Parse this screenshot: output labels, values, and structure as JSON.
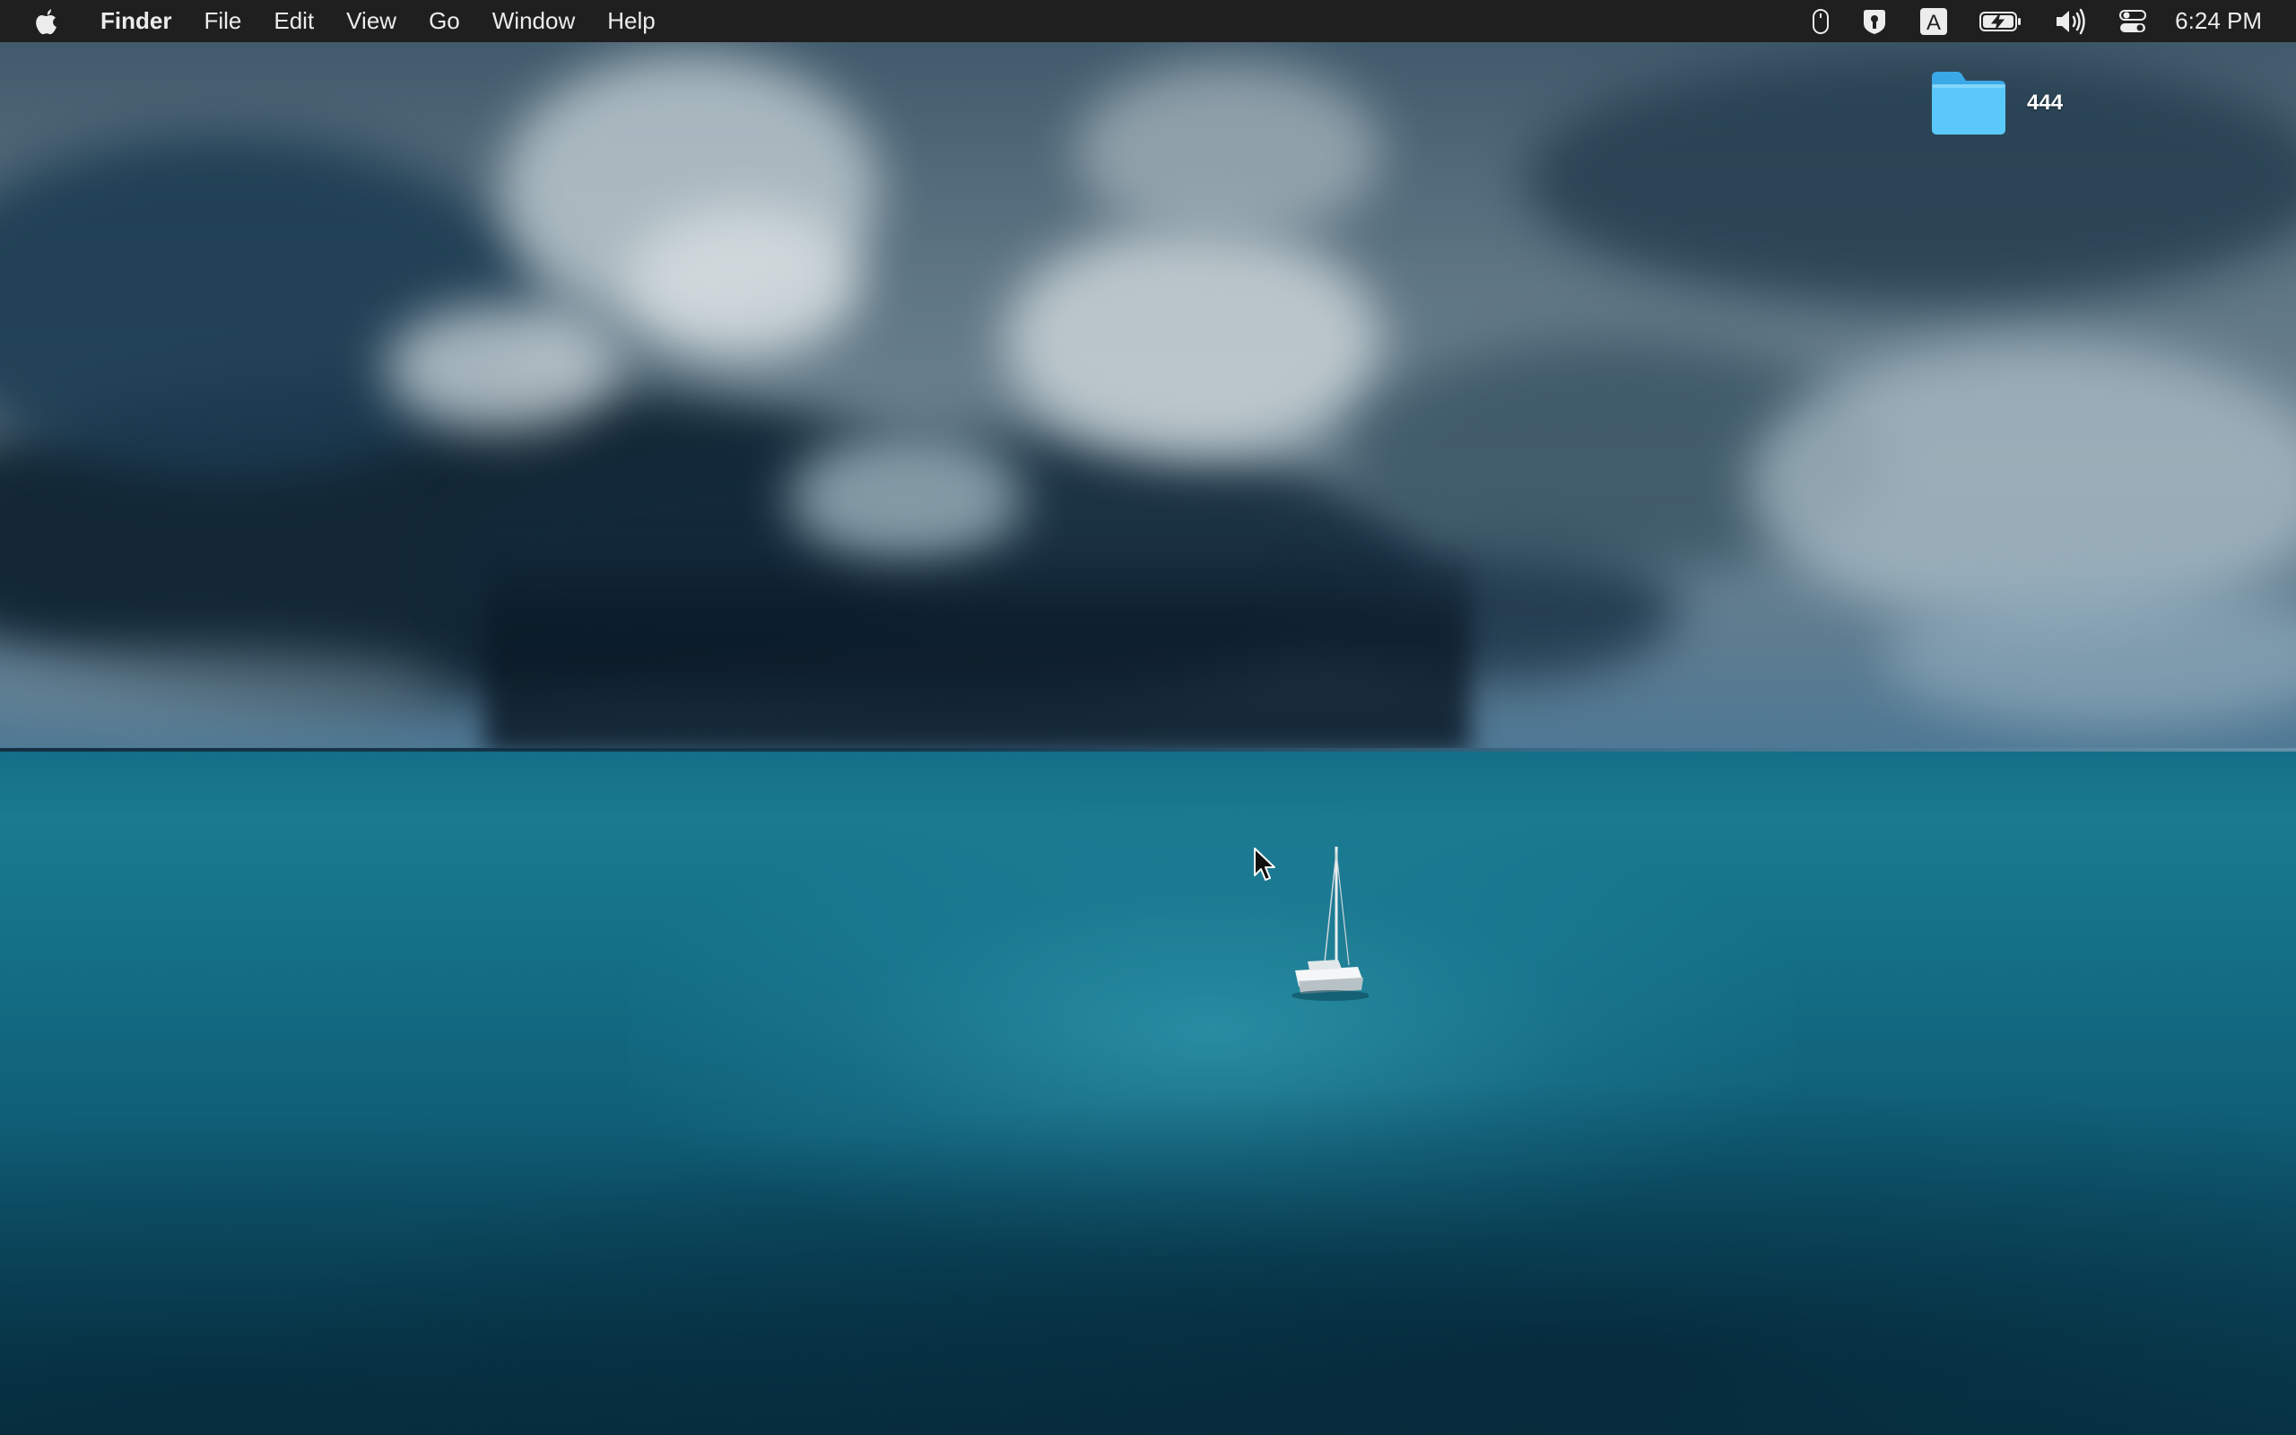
{
  "menubar": {
    "apple_icon": "apple-logo-icon",
    "app_name": "Finder",
    "menus": [
      "File",
      "Edit",
      "View",
      "Go",
      "Window",
      "Help"
    ],
    "status_icons": [
      "mouse-icon",
      "password-key-icon",
      "input-source-a-icon",
      "battery-charging-icon",
      "volume-icon",
      "control-center-icon"
    ],
    "input_source_letter": "A",
    "clock": "6:24 PM"
  },
  "desktop": {
    "folder": {
      "icon": "folder-icon",
      "label": "444",
      "color": "#5ac8fa"
    },
    "wallpaper": "storm-over-ocean-with-sailboat"
  },
  "colors": {
    "menubar_bg": "#1f1f1f",
    "menubar_text": "#ececec",
    "folder_blue": "#5ac8fa"
  }
}
